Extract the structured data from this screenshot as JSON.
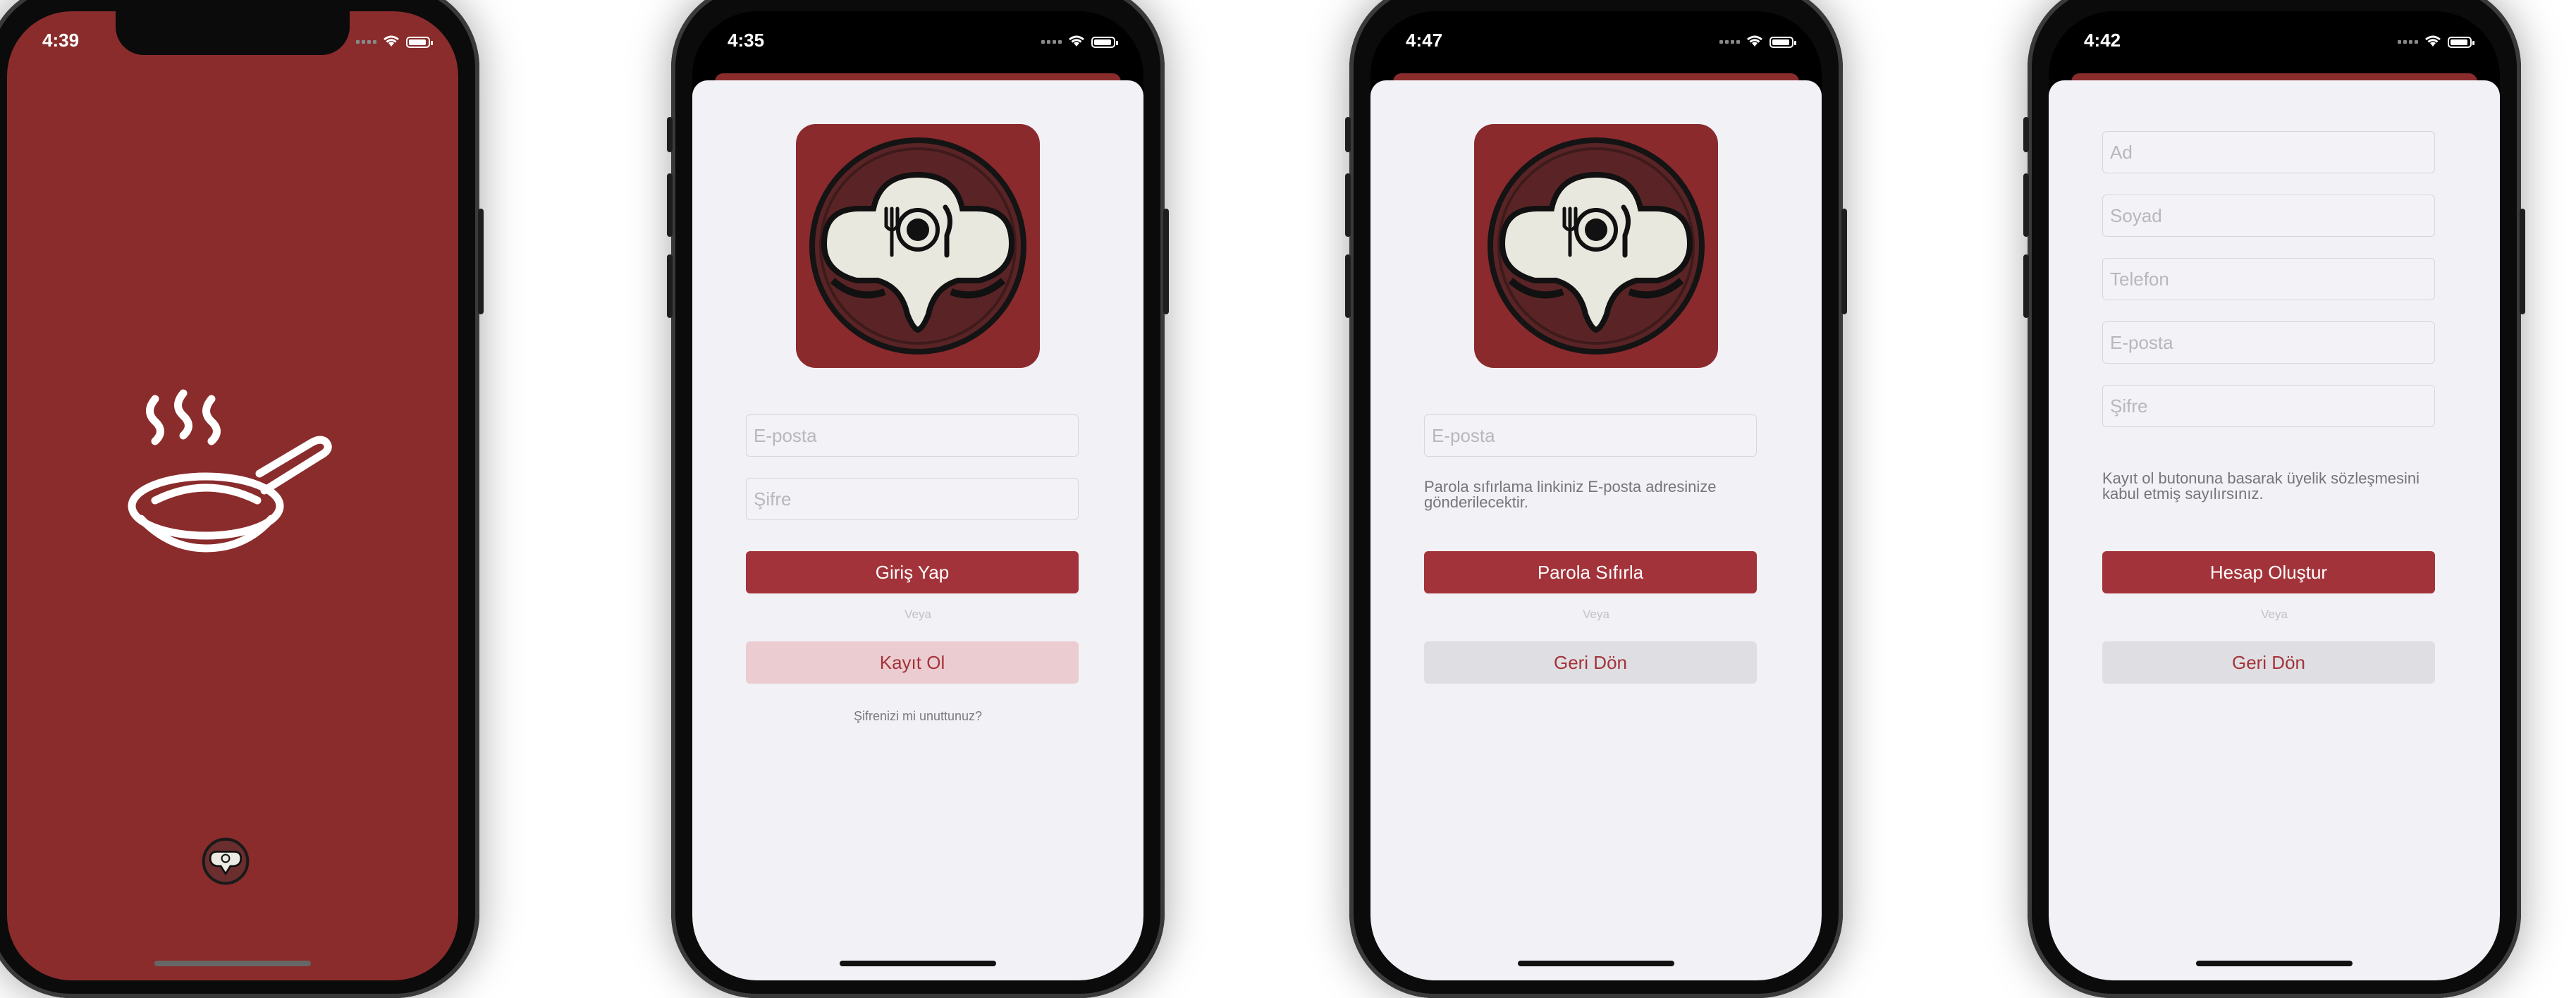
{
  "colors": {
    "brand_red": "#8b2a2d",
    "button_red": "#a3333a",
    "sheet_bg": "#f1f1f6"
  },
  "screens": {
    "splash": {
      "time": "4:39",
      "illustration": "frying-pan-steam",
      "bottom_logo": "chef-logo"
    },
    "login": {
      "time": "4:35",
      "email_placeholder": "E-posta",
      "password_placeholder": "Şifre",
      "login_button": "Giriş Yap",
      "or_label": "Veya",
      "register_button": "Kayıt Ol",
      "forgot_link": "Şifrenizi mi unuttunuz?"
    },
    "reset": {
      "time": "4:47",
      "email_placeholder": "E-posta",
      "info_text": "Parola sıfırlama linkiniz E-posta adresinize gönderilecektir.",
      "reset_button": "Parola Sıfırla",
      "or_label": "Veya",
      "back_button": "Geri Dön"
    },
    "register": {
      "time": "4:42",
      "first_name_placeholder": "Ad",
      "last_name_placeholder": "Soyad",
      "phone_placeholder": "Telefon",
      "email_placeholder": "E-posta",
      "password_placeholder": "Şifre",
      "terms_text": "Kayıt ol butonuna basarak üyelik sözleşmesini kabul etmiş sayılırsınız.",
      "create_button": "Hesap Oluştur",
      "or_label": "Veya",
      "back_button": "Geri Dön"
    }
  }
}
